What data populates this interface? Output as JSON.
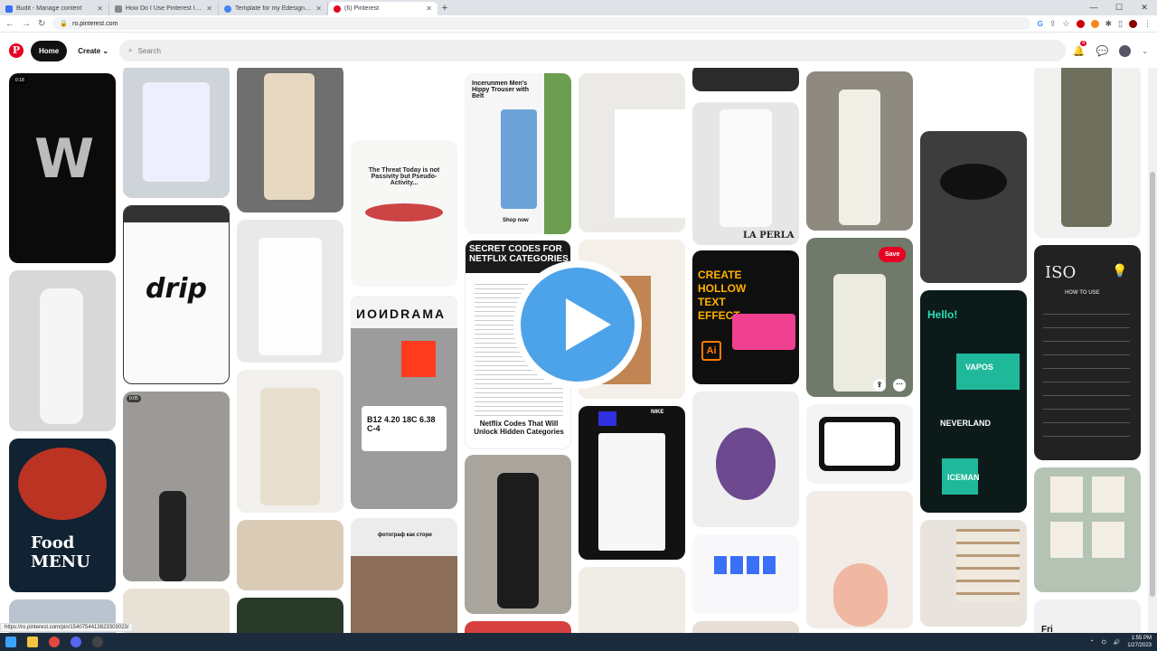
{
  "browser": {
    "tabs": [
      {
        "title": "Budit - Manage content",
        "color": "#3a6ff7"
      },
      {
        "title": "How Do I Use Pinterest Images",
        "color": "#888888"
      },
      {
        "title": "Template for my Edesigner ads",
        "color": "#4285f4"
      },
      {
        "title": "(6) Pinterest",
        "color": "#e60023",
        "active": true
      }
    ],
    "url": "ro.pinterest.com",
    "status_url": "https://ro.pinterest.com/pin/1540754413823303023/"
  },
  "header": {
    "logo": "P",
    "home_label": "Home",
    "create_label": "Create",
    "search_placeholder": "Search",
    "notif_count": "4"
  },
  "pins": [
    {
      "timer": "0:18",
      "text": "W"
    },
    {
      "text": "drip"
    },
    {
      "timer": "0:05"
    },
    {
      "text": "Food MENU"
    },
    {
      "text": "The Threat Today is not Passivity but Pseudo-Activity..."
    },
    {
      "text": "ИОИDRAMA"
    },
    {
      "text": "B12 4.20 18C 6.38 C-4"
    },
    {
      "text": "Incerunmen Men's Hippy Trouser with Belt"
    },
    {
      "text": "SECRET CODES FOR NETFLIX CATEGORIES"
    },
    {
      "text": "Netflix Codes That Will Unlock Hidden Categories"
    },
    {
      "text": "LA PERLA"
    },
    {
      "text": "CREATE HOLLOW TEXT EFFECT"
    },
    {
      "text": "Ai"
    },
    {
      "text": "Save"
    },
    {
      "text": "Hello!"
    },
    {
      "text": "VAPOS"
    },
    {
      "text": "NEVERLAND"
    },
    {
      "text": "ICEMAN"
    },
    {
      "text": "ISO"
    },
    {
      "text": "HOW TO USE"
    },
    {
      "text": "NIKE"
    },
    {
      "text": "Shop now"
    },
    {
      "text": "фотограф как стори"
    },
    {
      "text": "Fri"
    }
  ],
  "taskbar": {
    "time": "1:55 PM",
    "date": "1/27/2023"
  }
}
